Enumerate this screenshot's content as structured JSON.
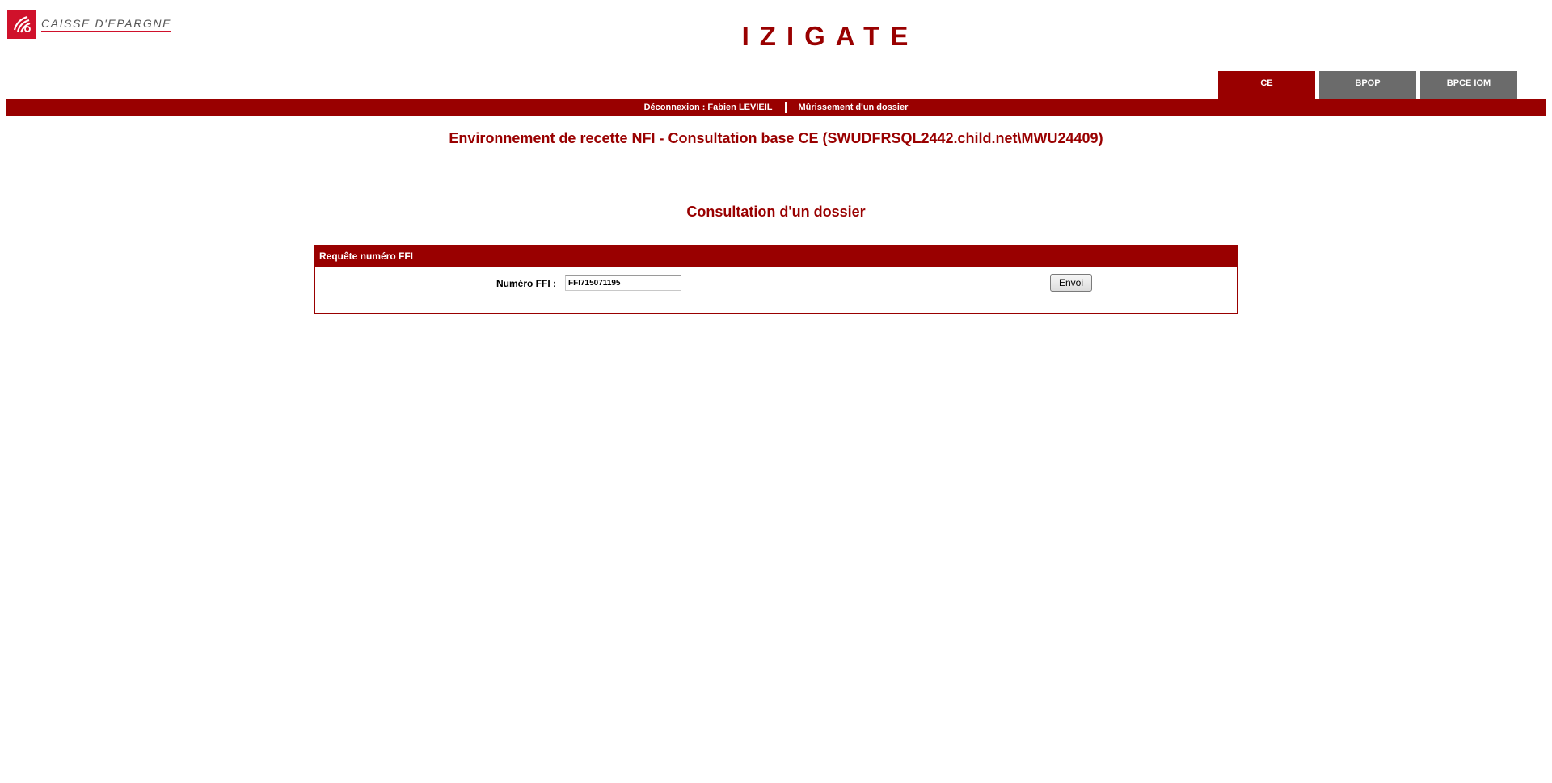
{
  "brand": {
    "logo_text": "CAISSE D'EPARGNE",
    "logo_color": "#d0112b"
  },
  "app_title": "IZIGATE",
  "tabs": [
    {
      "label": "CE",
      "active": true
    },
    {
      "label": "BPOP",
      "active": false
    },
    {
      "label": "BPCE IOM",
      "active": false
    }
  ],
  "nav": {
    "logout_label": "Déconnexion : Fabien LEVIEIL",
    "maturation_label": "Mûrissement d'un dossier"
  },
  "environment_title": "Environnement de recette NFI - Consultation base CE (SWUDFRSQL2442.child.net\\MWU24409)",
  "section_title": "Consultation d'un dossier",
  "form": {
    "panel_title": "Requête numéro FFI",
    "ffi_label": "Numéro FFI :",
    "ffi_value": "FFI715071195",
    "submit_label": "Envoi"
  },
  "colors": {
    "primary": "#990000",
    "tab_inactive": "#6b6b6b"
  }
}
